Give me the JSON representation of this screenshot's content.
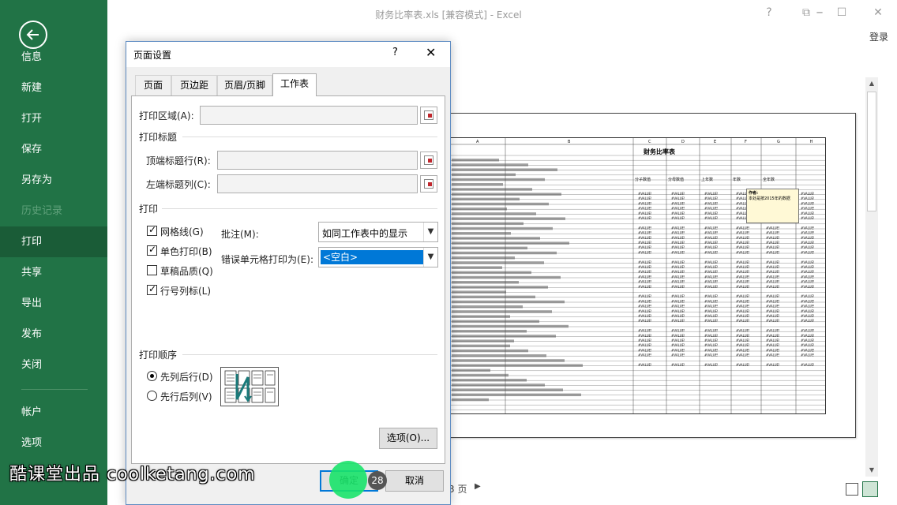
{
  "window": {
    "title": "财务比率表.xls  [兼容模式] - Excel",
    "login": "登录"
  },
  "sidebar": {
    "items": [
      {
        "label": "信息"
      },
      {
        "label": "新建"
      },
      {
        "label": "打开"
      },
      {
        "label": "保存"
      },
      {
        "label": "另存为"
      },
      {
        "label": "历史记录"
      },
      {
        "label": "打印"
      },
      {
        "label": "共享"
      },
      {
        "label": "导出"
      },
      {
        "label": "发布"
      },
      {
        "label": "关闭"
      },
      {
        "label": "帐户"
      },
      {
        "label": "选项"
      }
    ]
  },
  "preview": {
    "sheet_title": "财务比率表",
    "comment_author": "作者:",
    "comment_text": "本处是按2015年的数据",
    "page_suffix": "3 页",
    "col_letters": [
      "A",
      "B",
      "C",
      "D",
      "E",
      "F",
      "G",
      "H"
    ],
    "header_cells": [
      "分子数值",
      "分母数值",
      "上年数",
      "年数",
      "全年数"
    ],
    "cell_value": "#VALUE!"
  },
  "dialog": {
    "title": "页面设置",
    "help": "?",
    "close": "✕",
    "tabs": [
      {
        "label": "页面"
      },
      {
        "label": "页边距"
      },
      {
        "label": "页眉/页脚"
      },
      {
        "label": "工作表"
      }
    ],
    "print_area_label": "打印区域(A):",
    "print_titles_group": "打印标题",
    "top_rows_label": "顶端标题行(R):",
    "left_cols_label": "左端标题列(C):",
    "print_group": "打印",
    "checkboxes": [
      {
        "label": "网格线(G)",
        "checked": true
      },
      {
        "label": "单色打印(B)",
        "checked": true
      },
      {
        "label": "草稿品质(Q)",
        "checked": false
      },
      {
        "label": "行号列标(L)",
        "checked": true
      }
    ],
    "comments_label": "批注(M):",
    "comments_value": "如同工作表中的显示",
    "errors_label": "错误单元格打印为(E):",
    "errors_value": "<空白>",
    "order_group": "打印顺序",
    "radios": [
      {
        "label": "先列后行(D)",
        "checked": true
      },
      {
        "label": "先行后列(V)",
        "checked": false
      }
    ],
    "options_button": "选项(O)...",
    "ok_button": "确定",
    "cancel_button": "取消"
  },
  "overlay": {
    "click_count": "28",
    "watermark": "酷课堂出品 coolketang.com"
  },
  "colors": {
    "sidebar": "#217346",
    "sidebar_active": "#1a5c37",
    "selection": "#0078d7",
    "click_dot": "#19e36a"
  }
}
